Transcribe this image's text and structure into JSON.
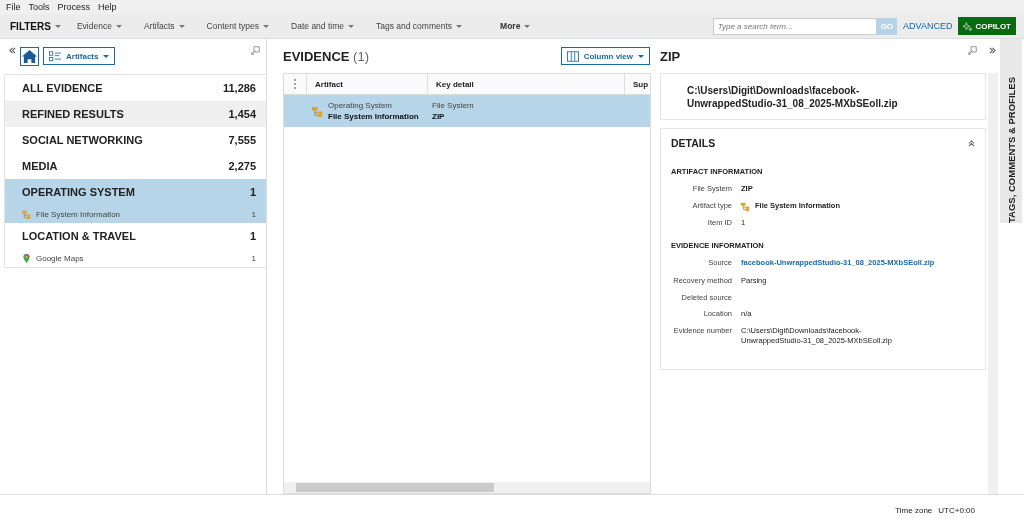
{
  "menu": [
    "File",
    "Tools",
    "Process",
    "Help"
  ],
  "filters": {
    "title": "FILTERS",
    "items": [
      "Evidence",
      "Artifacts",
      "Content types",
      "Date and time",
      "Tags and comments"
    ],
    "more": "More"
  },
  "search": {
    "placeholder": "Type a search term...",
    "go": "GO",
    "advanced": "ADVANCED",
    "copilot": "COPILOT"
  },
  "left_panel": {
    "view": "Artifacts",
    "categories": [
      {
        "name": "ALL EVIDENCE",
        "count": "11,286",
        "selected": false,
        "shaded": false
      },
      {
        "name": "REFINED RESULTS",
        "count": "1,454",
        "selected": false,
        "shaded": true
      },
      {
        "name": "SOCIAL NETWORKING",
        "count": "7,555",
        "selected": false,
        "shaded": false
      },
      {
        "name": "MEDIA",
        "count": "2,275",
        "selected": false,
        "shaded": false
      },
      {
        "name": "OPERATING SYSTEM",
        "count": "1",
        "selected": true,
        "shaded": false,
        "children": [
          {
            "name": "File System Information",
            "count": "1",
            "kind": "filesystem"
          }
        ]
      },
      {
        "name": "LOCATION & TRAVEL",
        "count": "1",
        "selected": false,
        "shaded": false,
        "children": [
          {
            "name": "Google Maps",
            "count": "1",
            "kind": "map"
          }
        ]
      }
    ]
  },
  "evidence": {
    "title": "EVIDENCE",
    "count": "(1)",
    "view": "Column view",
    "columns": [
      "Artifact",
      "Key detail",
      "Sup"
    ],
    "rows": [
      {
        "category": "Operating System",
        "artifact": "File System Information",
        "detail_1": "File System",
        "detail_2": "ZIP",
        "selected": true
      }
    ]
  },
  "detail": {
    "title": "ZIP",
    "path": "C:\\Users\\Digit\\Downloads\\facebook-UnwrappedStudio-31_08_2025-MXbSEoll.zip",
    "section": "DETAILS",
    "groups": [
      {
        "title": "ARTIFACT INFORMATION",
        "fields": [
          {
            "label": "File System",
            "value": "ZIP",
            "kind": "strong"
          },
          {
            "label": "Artifact type",
            "value": "File System Information",
            "kind": "artifact"
          },
          {
            "label": "Item ID",
            "value": "1",
            "kind": "plain"
          }
        ]
      },
      {
        "title": "EVIDENCE INFORMATION",
        "fields": [
          {
            "label": "Source",
            "value": "facebook-UnwrappedStudio-31_08_2025-MXbSEoll.zip",
            "kind": "link"
          },
          {
            "label": "Recovery method",
            "value": "Parsing",
            "kind": "plain"
          },
          {
            "label": "Deleted source",
            "kind": "plain"
          },
          {
            "label": "Location",
            "value": "n/a",
            "kind": "plain"
          },
          {
            "label": "Evidence number",
            "value": "C:\\Users\\Digit\\Downloads\\facebook-UnwrappedStudio-31_08_2025-MXbSEoll.zip",
            "kind": "plain"
          }
        ]
      }
    ]
  },
  "side_tab": "TAGS, COMMENTS & PROFILES",
  "status_bar": {
    "label": "Time zone",
    "value": "UTC+0:00"
  }
}
